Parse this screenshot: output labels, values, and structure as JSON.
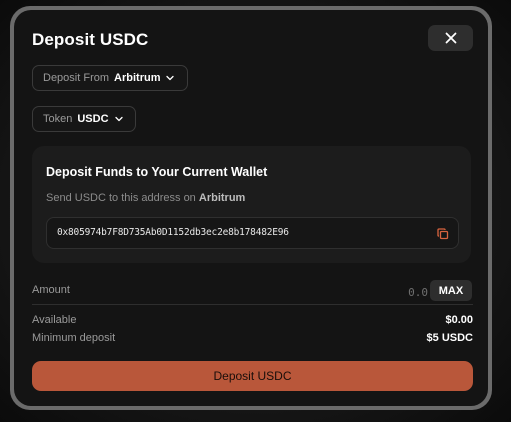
{
  "modal": {
    "title": "Deposit USDC",
    "close_icon": "close-icon"
  },
  "deposit_from": {
    "label": "Deposit From",
    "value": "Arbitrum"
  },
  "token": {
    "label": "Token",
    "value": "USDC"
  },
  "card": {
    "title": "Deposit Funds to Your Current Wallet",
    "subtitle_prefix": "Send USDC to this address on",
    "subtitle_network": "Arbitrum",
    "address": "0x805974b7F8D735Ab0D1152db3ec2e8b178482E96",
    "copy_icon": "copy-icon"
  },
  "amount": {
    "label": "Amount",
    "placeholder": "0.0",
    "max_label": "MAX"
  },
  "available": {
    "label": "Available",
    "value": "$0.00"
  },
  "minimum": {
    "label": "Minimum deposit",
    "value": "$5 USDC"
  },
  "submit": {
    "label": "Deposit USDC"
  },
  "colors": {
    "accent": "#b9573a",
    "copy_icon": "#d9643f"
  }
}
